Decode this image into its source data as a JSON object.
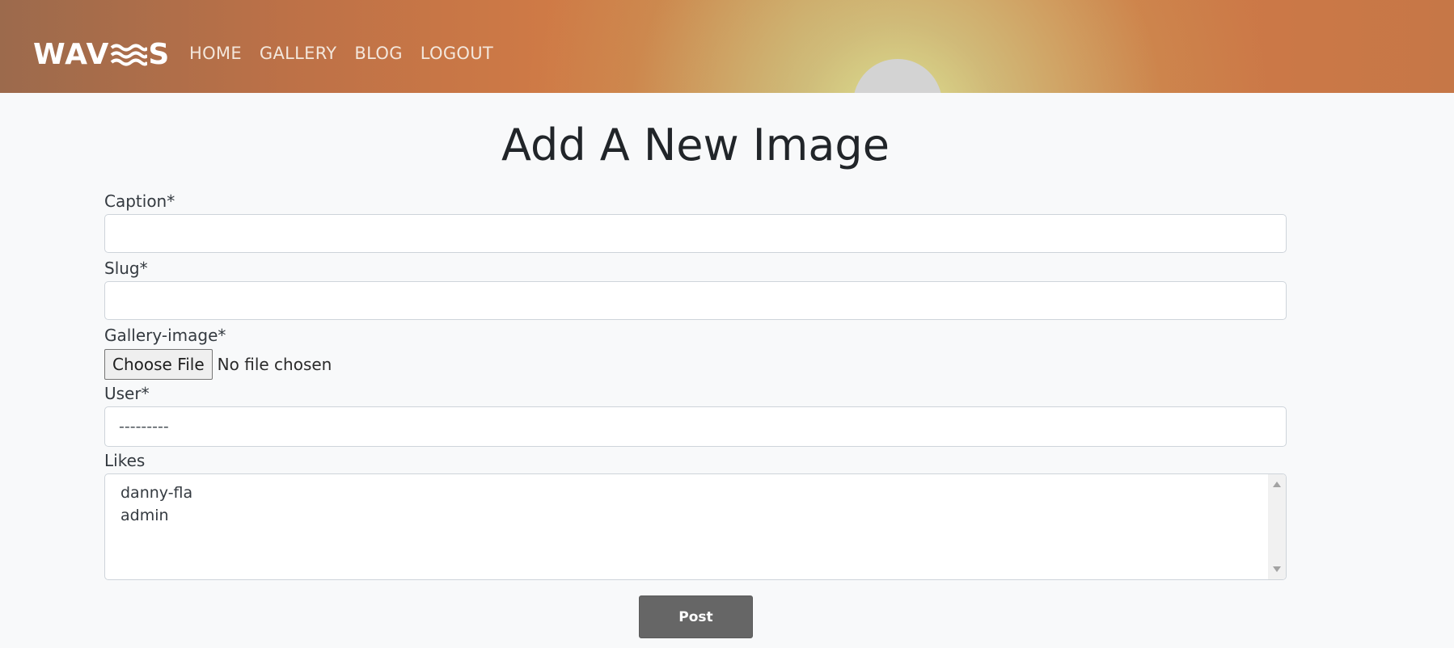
{
  "header": {
    "logo_prefix": "WAV",
    "logo_suffix": "S",
    "nav": [
      {
        "label": "HOME"
      },
      {
        "label": "GALLERY"
      },
      {
        "label": "BLOG"
      },
      {
        "label": "LOGOUT"
      }
    ]
  },
  "page": {
    "title": "Add A New Image"
  },
  "form": {
    "caption_label": "Caption*",
    "caption_value": "",
    "slug_label": "Slug*",
    "slug_value": "",
    "gallery_image_label": "Gallery-image*",
    "file_button_label": "Choose File",
    "file_status": "No file chosen",
    "user_label": "User*",
    "user_selected": "---------",
    "likes_label": "Likes",
    "likes_options": [
      "danny-fla",
      "admin"
    ],
    "submit_label": "Post"
  },
  "colors": {
    "header_accent": "#cf7a46",
    "background": "#f8f9fa",
    "button": "#666666"
  }
}
